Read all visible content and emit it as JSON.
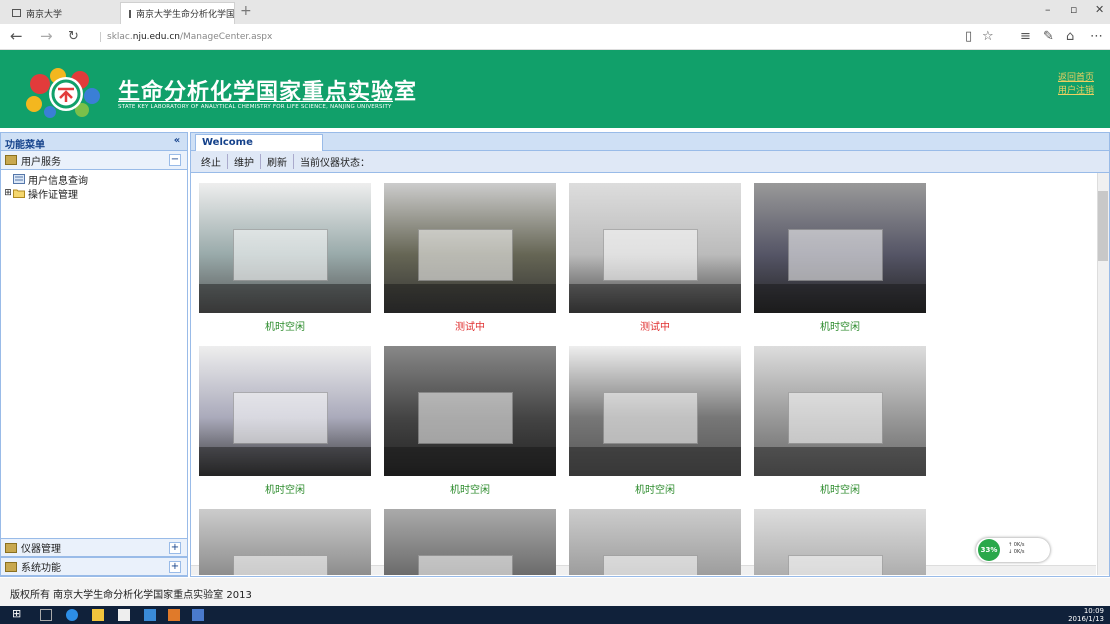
{
  "browser": {
    "tabs": [
      {
        "label": "南京大学"
      },
      {
        "label": "南京大学生命分析化学国"
      }
    ],
    "url_prefix": "sklac.",
    "url_domain": "nju.edu.cn",
    "url_path": "/ManageCenter.aspx"
  },
  "header": {
    "title_cn": "生命分析化学国家重点实验室",
    "title_en": "STATE KEY LABORATORY OF ANALYTICAL CHEMISTRY FOR LIFE SCIENCE, NANJING UNIVERSITY",
    "links": [
      "返回首页",
      "用户注销"
    ],
    "brand_color": "#11a06a"
  },
  "sidebar": {
    "title": "功能菜单",
    "panels": [
      {
        "label": "用户服务",
        "expanded": true,
        "items": [
          {
            "label": "用户信息查询",
            "icon": "form-icon"
          },
          {
            "label": "操作证管理",
            "icon": "folder-icon"
          }
        ]
      },
      {
        "label": "仪器管理",
        "expanded": false
      },
      {
        "label": "系统功能",
        "expanded": false
      }
    ]
  },
  "main": {
    "tab": "Welcome",
    "toolbar": [
      "终止",
      "维护",
      "刷新"
    ],
    "status_label": "当前仪器状态：",
    "instruments": [
      {
        "status": "机时空闲",
        "state": "idle"
      },
      {
        "status": "测试中",
        "state": "busy"
      },
      {
        "status": "测试中",
        "state": "busy"
      },
      {
        "status": "机时空闲",
        "state": "idle"
      },
      {
        "status": "机时空闲",
        "state": "idle"
      },
      {
        "status": "机时空闲",
        "state": "idle"
      },
      {
        "status": "机时空闲",
        "state": "idle"
      },
      {
        "status": "机时空闲",
        "state": "idle"
      },
      {
        "status": "",
        "state": "none"
      },
      {
        "status": "",
        "state": "none"
      },
      {
        "status": "",
        "state": "none"
      },
      {
        "status": "",
        "state": "none"
      }
    ],
    "status_colors": {
      "idle": "#2a8a2a",
      "busy": "#e03030"
    }
  },
  "network_widget": {
    "percent": "33%",
    "up": "0K/s",
    "down": "0K/s"
  },
  "footer": "版权所有 南京大学生命分析化学国家重点实验室 2013",
  "taskbar": {
    "time": "10:09",
    "date": "2016/1/13"
  }
}
